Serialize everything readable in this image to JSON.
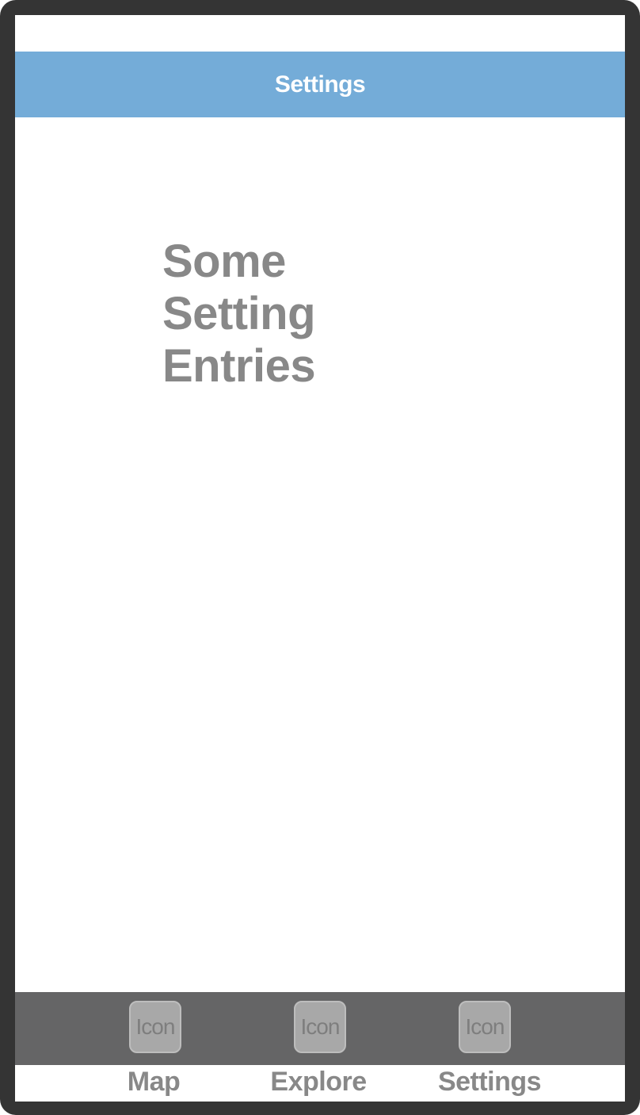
{
  "nav": {
    "title": "Settings"
  },
  "content": {
    "lines": [
      "Some",
      "Setting",
      "Entries"
    ]
  },
  "tabs": [
    {
      "icon_label": "Icon",
      "label": "Map",
      "icon": "placeholder-icon"
    },
    {
      "icon_label": "Icon",
      "label": "Explore",
      "icon": "placeholder-icon"
    },
    {
      "icon_label": "Icon",
      "label": "Settings",
      "icon": "placeholder-icon"
    }
  ],
  "colors": {
    "nav_background": "#74acd8",
    "tab_bar_background": "#656566",
    "device_frame": "#343434",
    "text_gray": "#888888"
  }
}
